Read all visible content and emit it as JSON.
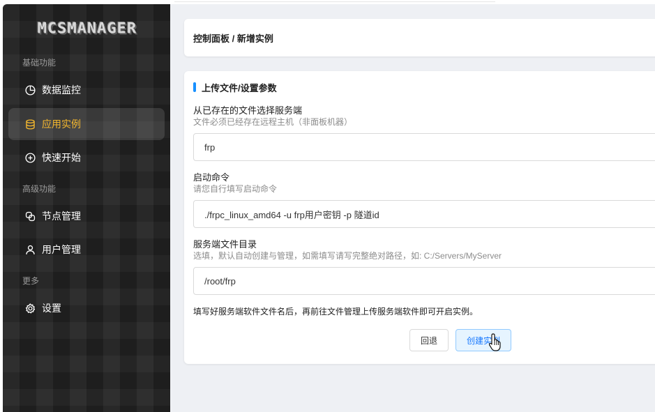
{
  "app": {
    "logo_text": "MCSMANAGER"
  },
  "sidebar": {
    "groups": [
      {
        "label": "基础功能"
      },
      {
        "label": "高级功能"
      },
      {
        "label": "更多"
      }
    ],
    "items": [
      {
        "label": "数据监控",
        "icon": "pie-chart-icon"
      },
      {
        "label": "应用实例",
        "icon": "database-icon",
        "active": true
      },
      {
        "label": "快速开始",
        "icon": "plus-circle-icon"
      },
      {
        "label": "节点管理",
        "icon": "nodes-icon"
      },
      {
        "label": "用户管理",
        "icon": "user-icon"
      },
      {
        "label": "设置",
        "icon": "gear-icon"
      }
    ]
  },
  "breadcrumb": {
    "text": "控制面板 / 新增实例"
  },
  "form": {
    "title": "上传文件/设置参数",
    "fields": [
      {
        "label": "从已存在的文件选择服务端",
        "hint": "文件必须已经存在远程主机（非面板机器）",
        "value": "frp"
      },
      {
        "label": "启动命令",
        "hint": "请您自行填写启动命令",
        "value": "./frpc_linux_amd64 -u frp用户密钥 -p 隧道id"
      },
      {
        "label": "服务端文件目录",
        "hint": "选填，默认自动创建与管理，如需填写请写完整绝对路径，如: C:/Servers/MyServer",
        "value": "/root/frp"
      }
    ],
    "note": "填写好服务端软件文件名后，再前往文件管理上传服务端软件即可开启实例。",
    "back_label": "回退",
    "create_label": "创建实例"
  },
  "colors": {
    "accent": "#1890ff",
    "active_nav": "#f5b82e",
    "sidebar_bg": "#232323",
    "main_bg": "#eef0f4"
  }
}
